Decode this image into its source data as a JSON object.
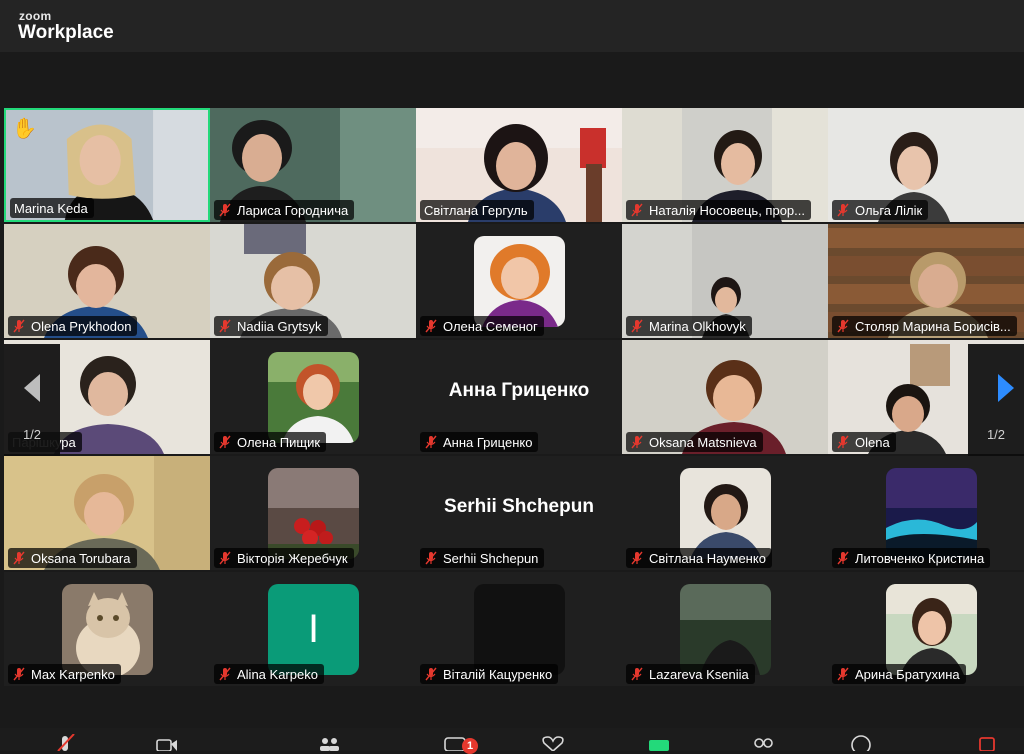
{
  "app": {
    "brand_small": "zoom",
    "brand_big": "Workplace"
  },
  "participants": [
    {
      "name": "Marina Keda",
      "muted": false,
      "hand": true,
      "active": true
    },
    {
      "name": "Лариса Городнича",
      "muted": true
    },
    {
      "name": "Світлана Гергуль",
      "muted": false
    },
    {
      "name": "Наталія Носовець, прор...",
      "muted": true
    },
    {
      "name": "Ольга Лілік",
      "muted": true
    },
    {
      "name": "Olena Prykhodon",
      "muted": true
    },
    {
      "name": "Nadiia Grytsyk",
      "muted": true
    },
    {
      "name": "Олена Семеног",
      "muted": true
    },
    {
      "name": "Marina Olkhovyk",
      "muted": true
    },
    {
      "name": "Столяр Марина Борисів...",
      "muted": true
    },
    {
      "name": "Парішкура",
      "muted": false
    },
    {
      "name": "Олена Пищик",
      "muted": true
    },
    {
      "name": "Анна Гриценко",
      "muted": true,
      "bigname": "Анна Гриценко"
    },
    {
      "name": "Oksana Matsnieva",
      "muted": true
    },
    {
      "name": "Olena",
      "muted": true
    },
    {
      "name": "Oksana Torubara",
      "muted": true
    },
    {
      "name": "Вікторія Жеребчук",
      "muted": true
    },
    {
      "name": "Serhii Shchepun",
      "muted": true,
      "bigname": "Serhii Shchepun"
    },
    {
      "name": "Світлана Науменко",
      "muted": true
    },
    {
      "name": "Литовченко Кристина",
      "muted": true
    },
    {
      "name": "Max Karpenko",
      "muted": true
    },
    {
      "name": "Alina Karpeko",
      "muted": true,
      "initial": "I"
    },
    {
      "name": "Віталій Кацуренко",
      "muted": true
    },
    {
      "name": "Lazareva Kseniia",
      "muted": true
    },
    {
      "name": "Арина Братухина",
      "muted": true
    }
  ],
  "pagination": {
    "left": "1/2",
    "right": "1/2"
  },
  "toolbar": {
    "chat_badge": "1"
  },
  "colors": {
    "active_border": "#23d97a",
    "mute_red": "#e5382e",
    "arrow_right": "#2d8cff",
    "arrow_left": "#bdbdbd"
  }
}
